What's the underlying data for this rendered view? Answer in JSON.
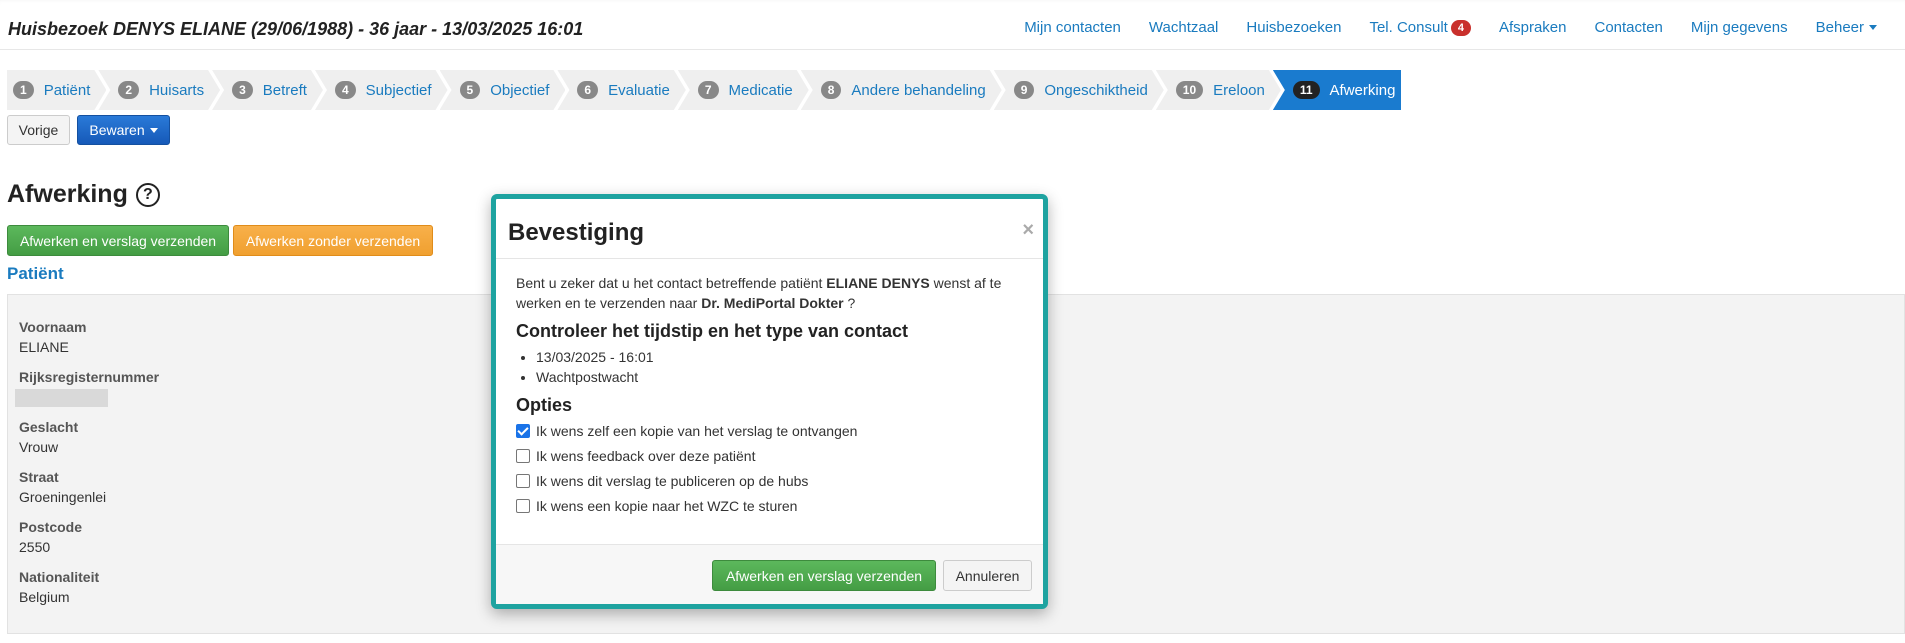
{
  "header": {
    "title": "Huisbezoek DENYS ELIANE (29/06/1988) - 36 jaar - 13/03/2025 16:01",
    "nav": [
      {
        "label": "Mijn contacten"
      },
      {
        "label": "Wachtzaal"
      },
      {
        "label": "Huisbezoeken"
      },
      {
        "label": "Tel. Consult",
        "badge": "4"
      },
      {
        "label": "Afspraken"
      },
      {
        "label": "Contacten"
      },
      {
        "label": "Mijn gegevens"
      },
      {
        "label": "Beheer"
      }
    ]
  },
  "steps": [
    {
      "num": "1",
      "label": "Patiënt"
    },
    {
      "num": "2",
      "label": "Huisarts"
    },
    {
      "num": "3",
      "label": "Betreft"
    },
    {
      "num": "4",
      "label": "Subjectief"
    },
    {
      "num": "5",
      "label": "Objectief"
    },
    {
      "num": "6",
      "label": "Evaluatie"
    },
    {
      "num": "7",
      "label": "Medicatie"
    },
    {
      "num": "8",
      "label": "Andere behandeling"
    },
    {
      "num": "9",
      "label": "Ongeschiktheid"
    },
    {
      "num": "10",
      "label": "Ereloon"
    },
    {
      "num": "11",
      "label": "Afwerking"
    }
  ],
  "active_step": "11",
  "toolbar": {
    "back_label": "Vorige",
    "save_label": "Bewaren"
  },
  "page": {
    "title": "Afwerking",
    "help_icon": "?",
    "finish_send_label": "Afwerken en verslag verzenden",
    "finish_nosend_label": "Afwerken zonder verzenden",
    "section_title": "Patiënt"
  },
  "patient": {
    "fields": [
      {
        "label": "Voornaam",
        "value": "ELIANE"
      },
      {
        "label": "Rijksregisternummer",
        "value": ""
      },
      {
        "label": "Geslacht",
        "value": "Vrouw"
      },
      {
        "label": "Straat",
        "value": "Groeningenlei"
      },
      {
        "label": "Postcode",
        "value": "2550"
      },
      {
        "label": "Nationaliteit",
        "value": "Belgium"
      }
    ]
  },
  "modal": {
    "title": "Bevestiging",
    "close": "×",
    "intro_pre": "Bent u zeker dat u het contact betreffende patiënt ",
    "intro_patient": "ELIANE DENYS",
    "intro_mid": " wenst af te werken en te verzenden naar ",
    "intro_doctor": "Dr. MediPortal Dokter",
    "intro_post": " ?",
    "check_heading": "Controleer het tijdstip en het type van contact",
    "check_items": [
      "13/03/2025 - 16:01",
      "Wachtpostwacht"
    ],
    "options_heading": "Opties",
    "options": [
      {
        "label": "Ik wens zelf een kopie van het verslag te ontvangen",
        "checked": true
      },
      {
        "label": "Ik wens feedback over deze patiënt",
        "checked": false
      },
      {
        "label": "Ik wens dit verslag te publiceren op de hubs",
        "checked": false
      },
      {
        "label": "Ik wens een kopie naar het WZC te sturen",
        "checked": false
      }
    ],
    "confirm_label": "Afwerken en verslag verzenden",
    "cancel_label": "Annuleren"
  }
}
